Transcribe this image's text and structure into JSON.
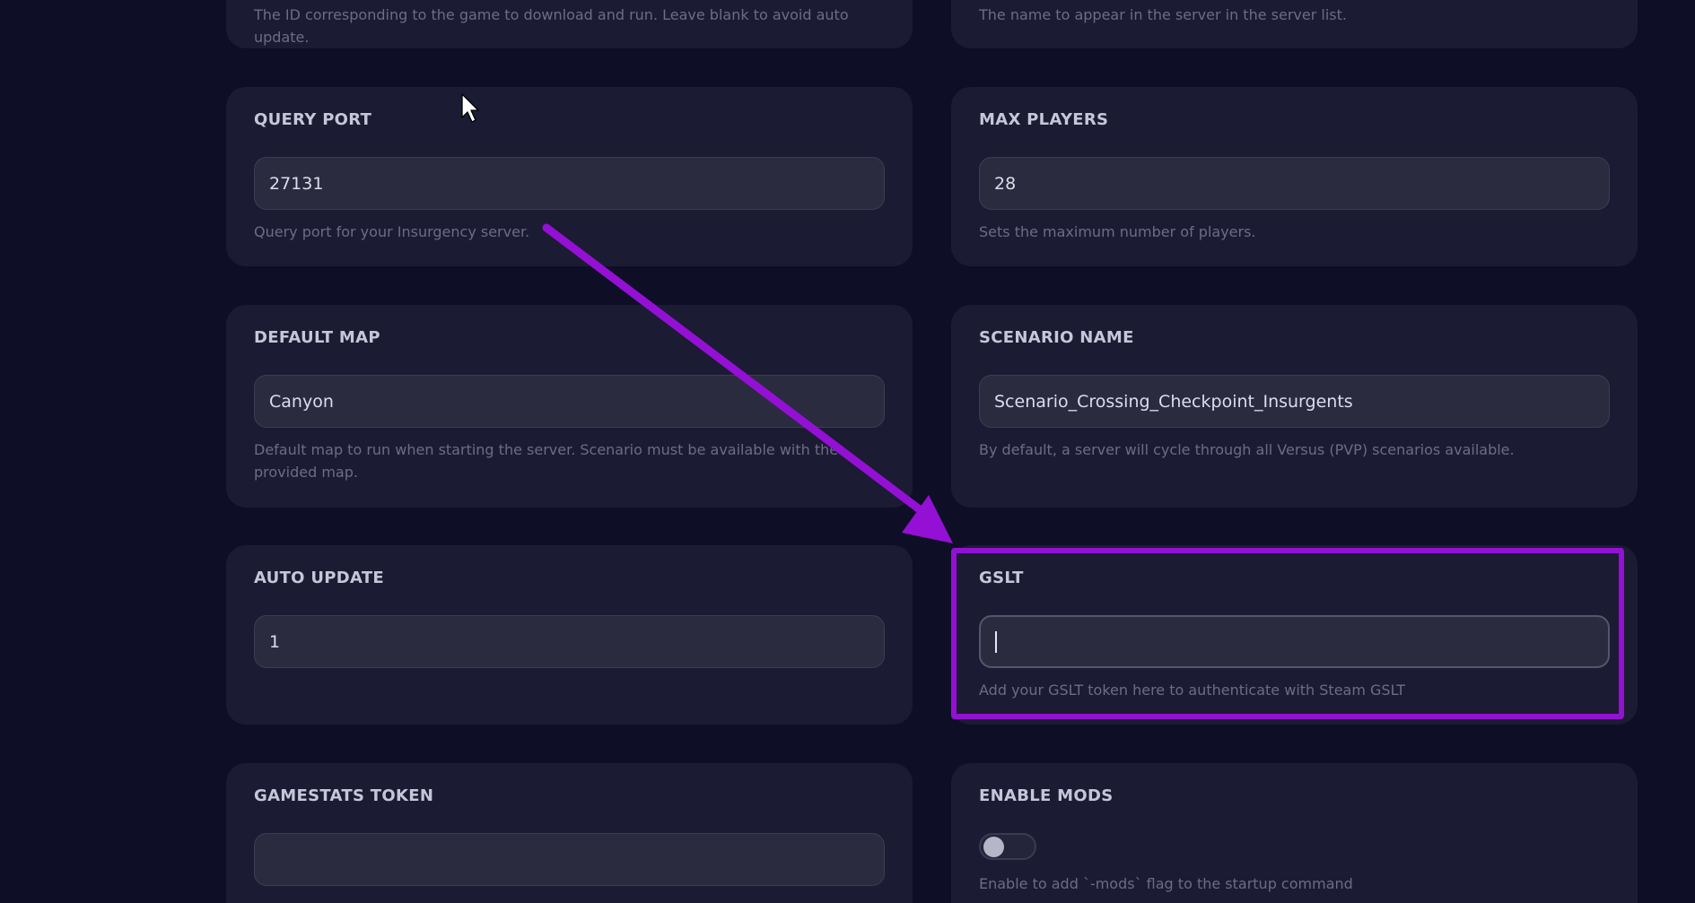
{
  "top_row": {
    "left_help": "The ID corresponding to the game to download and run. Leave blank to avoid auto update.",
    "right_help": "The name to appear in the server in the server list."
  },
  "query_port": {
    "label": "QUERY PORT",
    "value": "27131",
    "help": "Query port for your Insurgency server."
  },
  "max_players": {
    "label": "MAX PLAYERS",
    "value": "28",
    "help": "Sets the maximum number of players."
  },
  "default_map": {
    "label": "DEFAULT MAP",
    "value": "Canyon",
    "help": "Default map to run when starting the server. Scenario must be available with the provided map."
  },
  "scenario_name": {
    "label": "SCENARIO NAME",
    "value": "Scenario_Crossing_Checkpoint_Insurgents",
    "help": "By default, a server will cycle through all Versus (PVP) scenarios available."
  },
  "auto_update": {
    "label": "AUTO UPDATE",
    "value": "1"
  },
  "gslt": {
    "label": "GSLT",
    "value": "",
    "help": "Add your GSLT token here to authenticate with Steam GSLT"
  },
  "gamestats_token": {
    "label": "GAMESTATS TOKEN",
    "value": ""
  },
  "enable_mods": {
    "label": "ENABLE MODS",
    "enabled": false,
    "help": "Enable to add `-mods` flag to the startup command"
  },
  "annotation": {
    "highlight_color": "#9410d4",
    "arrow_color": "#9410d4"
  },
  "colors": {
    "page_bg": "#0e0e26",
    "card_bg": "#1b1b33",
    "input_bg": "#2b2b40"
  }
}
